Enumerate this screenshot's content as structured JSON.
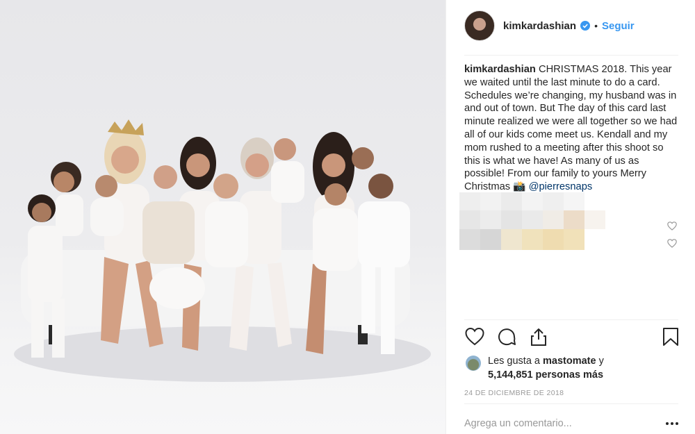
{
  "photo": {
    "alt_semantic": "family-photo",
    "background": "#ececee"
  },
  "header": {
    "username": "kimkardashian",
    "separator": "•",
    "follow_label": "Seguir",
    "verified_icon": "verified-badge-icon"
  },
  "caption": {
    "username": "kimkardashian",
    "text": " CHRISTMAS 2018. This year we waited until the last minute to do a card. Schedules we’re changing, my husband was in and out of town. But The day of this card last minute realized we were all together so we had all of our kids come meet us. Kendall and my mom rushed to a meeting after this shoot so this is what we have! As many of us as possible! From our family to yours Merry Christmas ",
    "emoji": "📸",
    "mention": " @pierresnaps"
  },
  "actions": {
    "like_icon": "heart-icon",
    "comment_icon": "comment-icon",
    "share_icon": "share-icon",
    "save_icon": "bookmark-icon"
  },
  "likes": {
    "prefix": "Les gusta a ",
    "user": "mastomate",
    "joiner": " y",
    "count": "5,144,851 personas más"
  },
  "date": "24 DE DICIEMBRE DE 2018",
  "comment": {
    "placeholder": "Agrega un comentario...",
    "more_icon": "more-options-icon"
  },
  "colors": {
    "link_blue": "#3897f0",
    "mention_blue": "#003569",
    "text": "#262626",
    "muted": "#999999",
    "divider": "#efefef"
  }
}
